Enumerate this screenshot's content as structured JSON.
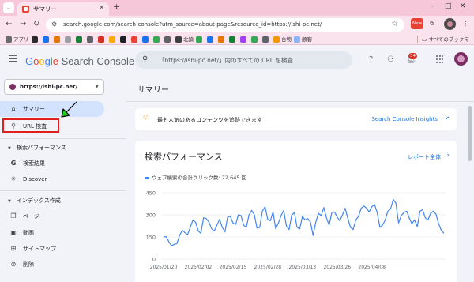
{
  "browser": {
    "tab_title": "サマリー",
    "url": "search.google.com/search-console?utm_source=about-page&resource_id=https://ishi-pc.net/",
    "new_badge": "New",
    "bookmarks": [
      {
        "label": "アプリ",
        "color": "#6b6b6b"
      },
      {
        "label": "",
        "color": "#2b2b2b"
      },
      {
        "label": "",
        "color": "#1a73e8"
      },
      {
        "label": "",
        "color": "#e37400"
      },
      {
        "label": "",
        "color": "#9aa0a6"
      },
      {
        "label": "",
        "color": "#188038"
      },
      {
        "label": "",
        "color": "#5f6368"
      },
      {
        "label": "",
        "color": "#d93025"
      },
      {
        "label": "",
        "color": "#f9ab00"
      },
      {
        "label": "",
        "color": "#202124"
      },
      {
        "label": "",
        "color": "#ea4335"
      },
      {
        "label": "",
        "color": "#1a73e8"
      },
      {
        "label": "",
        "color": "#34a853"
      },
      {
        "label": "",
        "color": "#5f6368"
      },
      {
        "label": "北鎮",
        "color": "#3c4043"
      },
      {
        "label": "",
        "color": "#34a853"
      },
      {
        "label": "",
        "color": "#1a73e8"
      },
      {
        "label": "",
        "color": "#e37400"
      },
      {
        "label": "",
        "color": "#188038"
      },
      {
        "label": "",
        "color": "#a142f4"
      },
      {
        "label": "",
        "color": "#34a853"
      },
      {
        "label": "",
        "color": "#5f6368"
      },
      {
        "label": "合物",
        "color": "#f29900"
      },
      {
        "label": "顧客",
        "color": "#8ab4f8"
      }
    ],
    "all_bookmarks": "すべてのブックマーク"
  },
  "header": {
    "logo": {
      "g1": "G",
      "g2": "o",
      "g3": "o",
      "g4": "g",
      "g5": "l",
      "g6": "e",
      "product": "Search Console"
    },
    "search_placeholder": "「https://ishi-pc.net/」内のすべての URL を検査",
    "notification_count": "34"
  },
  "sidebar": {
    "property": "https://ishi-pc.net/",
    "items": [
      {
        "label": "サマリー",
        "icon": "home-icon"
      },
      {
        "label": "URL 検査",
        "icon": "search-icon"
      }
    ],
    "sections": [
      {
        "title": "検索パフォーマンス",
        "items": [
          {
            "label": "検索結果",
            "icon": "google-g-icon"
          },
          {
            "label": "Discover",
            "icon": "asterisk-icon"
          }
        ]
      },
      {
        "title": "インデックス作成",
        "items": [
          {
            "label": "ページ",
            "icon": "pages-icon"
          },
          {
            "label": "動画",
            "icon": "video-icon"
          },
          {
            "label": "サイトマップ",
            "icon": "sitemap-icon"
          },
          {
            "label": "削除",
            "icon": "removal-icon"
          }
        ]
      }
    ]
  },
  "main": {
    "page_title": "サマリー",
    "insight_text": "最も人気のあるコンテンツを追跡できます",
    "insight_link": "Search Console Insights",
    "performance_title": "検索パフォーマンス",
    "report_link": "レポート全体",
    "legend": "ウェブ検索の合計クリック数: 22,645 回"
  },
  "colors": {
    "accent": "#1a73e8",
    "line": "#4285f4",
    "highlight": "#e01e1e",
    "arrow": "#1fd01f"
  },
  "chart_data": {
    "type": "line",
    "series": [
      {
        "name": "ウェブ検索の合計クリック数: 22,645 回",
        "values": [
          150,
          152,
          118,
          90,
          100,
          105,
          160,
          195,
          180,
          165,
          215,
          265,
          250,
          190,
          175,
          280,
          275,
          250,
          205,
          190,
          230,
          270,
          215,
          185,
          285,
          290,
          245,
          235,
          300,
          295,
          230,
          215,
          300,
          330,
          300,
          210,
          215,
          325,
          355,
          270,
          260,
          320,
          205,
          245,
          295,
          330,
          225,
          200,
          300,
          315,
          215,
          205,
          290,
          265,
          275,
          250,
          160,
          250,
          310,
          295,
          350,
          280,
          230,
          315,
          320,
          285,
          260,
          300,
          345,
          275,
          215,
          200,
          265,
          290,
          345,
          360,
          345,
          320,
          355,
          370,
          315,
          215,
          230,
          265,
          325,
          340,
          405,
          380,
          245,
          295,
          315,
          325,
          280,
          240,
          265,
          220,
          325,
          335,
          280,
          265,
          310,
          325,
          305,
          240,
          195,
          175
        ]
      }
    ],
    "x_tick_labels": [
      "2025/01/20",
      "2025/02/02",
      "2025/02/15",
      "2025/02/28",
      "2025/03/13",
      "2025/03/26",
      "2025/04/08"
    ],
    "x_tick_positions": [
      0,
      13,
      26,
      39,
      52,
      65,
      78
    ],
    "y_ticks": [
      0,
      150,
      300,
      450
    ],
    "ylim": [
      0,
      450
    ],
    "grid": true
  }
}
